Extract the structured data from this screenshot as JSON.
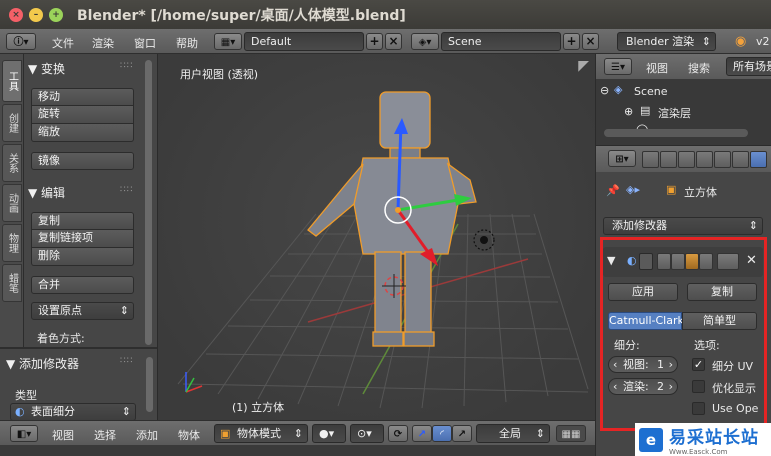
{
  "window": {
    "title": "Blender* [/home/super/桌面/人体模型.blend]"
  },
  "top_menu": {
    "items": [
      "文件",
      "渲染",
      "窗口",
      "帮助"
    ],
    "layout": "Default",
    "scene": "Scene",
    "engine": "Blender 渲染",
    "version": "v2"
  },
  "left_tabs": [
    "工具",
    "创建",
    "关系",
    "动画",
    "物理",
    "蜡笔"
  ],
  "tool_panel": {
    "transform_header": "▼ 变换",
    "transform_buttons": [
      "移动",
      "旋转",
      "缩放"
    ],
    "mirror": "镜像",
    "edit_header": "▼ 编辑",
    "edit_buttons": [
      "复制",
      "复制链接项",
      "删除"
    ],
    "join": "合并",
    "set_origin": "设置原点",
    "shading_label": "着色方式:",
    "add_modifier_header": "▼ 添加修改器",
    "type_label": "类型",
    "type_value": "表面细分"
  },
  "viewport": {
    "label": "用户视图 (透视)",
    "object_label": "(1) 立方体"
  },
  "bottom_bar": {
    "items": [
      "视图",
      "选择",
      "添加",
      "物体"
    ],
    "mode": "物体模式",
    "pivot": "全局"
  },
  "outliner": {
    "header_items": [
      "视图",
      "搜索"
    ],
    "filter": "所有场景",
    "tree": [
      "Scene",
      "渲染层"
    ]
  },
  "properties": {
    "breadcrumb_object": "立方体",
    "add_modifier": "添加修改器",
    "apply": "应用",
    "copy": "复制",
    "subdiv_type_active": "Catmull-Clark",
    "subdiv_type_other": "简单型",
    "subdivisions_label": "细分:",
    "options_label": "选项:",
    "view_label": "视图:",
    "view_value": "1",
    "render_label": "渲染:",
    "render_value": "2",
    "opt_uv": "细分 UV",
    "opt_uv_checked": true,
    "opt_display": "优化显示",
    "opt_opensubdiv": "Use Ope"
  },
  "watermark": {
    "brand": "易采站长站",
    "sub": "Www.Easck.Com"
  },
  "colors": {
    "accent_blue": "#5680c2",
    "highlight_red": "#e52424",
    "selection_orange": "#f09c2a"
  }
}
